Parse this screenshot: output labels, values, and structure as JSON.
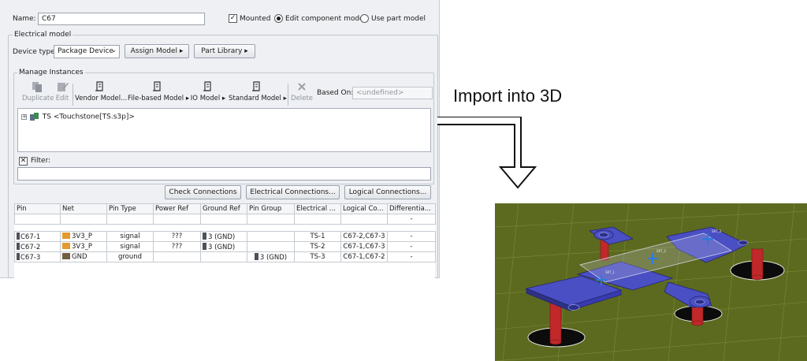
{
  "form": {
    "name_label": "Name:",
    "name_value": "C67",
    "mounted_label": "Mounted",
    "mounted_checked": true,
    "edit_model_label": "Edit component model",
    "use_part_label": "Use part model",
    "selected_mode": "Edit component model"
  },
  "electrical": {
    "title": "Electrical model",
    "device_type_label": "Device type:",
    "device_type_value": "Package Device",
    "assign_model": "Assign Model ▸",
    "part_library": "Part Library ▸"
  },
  "instances": {
    "title": "Manage Instances",
    "toolbar": {
      "duplicate": "Duplicate",
      "edit": "Edit",
      "vendor_model": "Vendor Model...",
      "file_model": "File-based Model ▸",
      "io_model": "IO Model ▸",
      "standard_model": "Standard Model ▸",
      "delete": "Delete",
      "based_on_label": "Based On:",
      "based_on_value": "<undefined>"
    },
    "tree_item": "TS <Touchstone[TS.s3p]>",
    "filter_label": "Filter:",
    "filter_value": ""
  },
  "actions": {
    "check": "Check Connections",
    "electrical": "Electrical Connections...",
    "logical": "Logical Connections..."
  },
  "table": {
    "headers": [
      "Pin",
      "Net",
      "Pin Type",
      "Power Ref",
      "Ground Ref",
      "Pin Group",
      "Electrical ...",
      "Logical Co...",
      "Differentia..."
    ],
    "filter_row": [
      "",
      "",
      "",
      "",
      "",
      "",
      "",
      "",
      "-"
    ],
    "rows": [
      [
        "C67-1",
        "3V3_P",
        "signal",
        "???",
        "3 (GND)",
        "",
        "TS-1",
        "C67-2,C67-3",
        "-"
      ],
      [
        "C67-2",
        "3V3_P",
        "signal",
        "???",
        "3 (GND)",
        "",
        "TS-2",
        "C67-1,C67-3",
        "-"
      ],
      [
        "C67-3",
        "GND",
        "ground",
        "",
        "",
        "3 (GND)",
        "TS-3",
        "C67-1,C67-2",
        "-"
      ]
    ]
  },
  "annotation": {
    "text": "Import into 3D"
  },
  "view3d": {
    "port_labels": [
      "SRT_1",
      "SRT_2",
      "SRT_3"
    ],
    "colors": {
      "background": "#5c6a20",
      "pad": "#4a4fc4",
      "pillar": "#c0282a"
    }
  }
}
